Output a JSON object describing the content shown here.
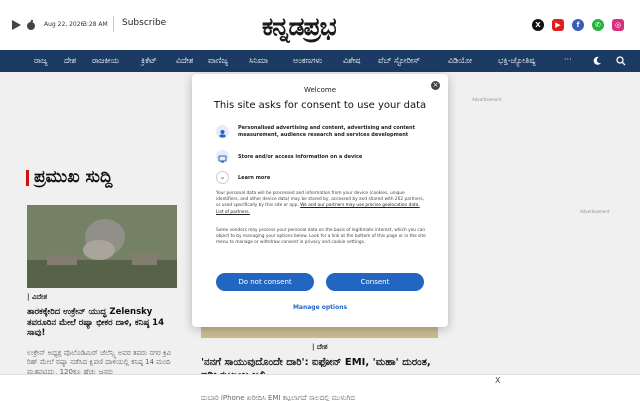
{
  "header": {
    "date": "Aug 22, 2026",
    "time": "3:28 AM",
    "subscribe_label": "Subscribe",
    "logo_text": "ಕನ್ನಡಪ್ರಭ",
    "left_icons": [
      "play-store-icon",
      "apple-icon"
    ],
    "social_icons": [
      "x-icon",
      "youtube-icon",
      "facebook-icon",
      "whatsapp-icon",
      "instagram-icon"
    ],
    "colors": {
      "nav_bg": "#1c3b64",
      "accent": "#d11111"
    }
  },
  "nav": {
    "items": [
      "ರಾಜ್ಯ",
      "ದೇಶ",
      "ರಾಜಕೀಯ",
      "ಕ್ರಿಕೆಟ್",
      "ವಿದೇಶ",
      "ವಾಣಿಜ್ಯ",
      "ಸಿನಿಮಾ",
      "ಅಂಕಣಗಳು",
      "ವಿಶೇಷ",
      "ವೆಬ್ ಸ್ಟೋರೀಸ್",
      "ವಿಡಿಯೋ",
      "ಭಕ್ತಿ-ಜ್ಯೋತಿಷ್ಯ"
    ],
    "more_label": "···",
    "theme_icon": "moon-icon",
    "search_icon": "search-icon"
  },
  "main": {
    "section_title": "ಪ್ರಮುಖ ಸುದ್ದಿ",
    "left_story": {
      "category": "| ವಿದೇಶ",
      "headline": "ತಾರಕಕ್ಕೇರಿದ ಉಕ್ರೇನ್ ಯುದ್ಧ Zelensky ತವರೂರಿನ ಮೇಲೆ ರಷ್ಯಾ ಭೀಕರ ದಾಳಿ, ಕನಿಷ್ಠ 14 ಸಾವು!",
      "summary": "ಉಕ್ರೇನ್ ಅಧ್ಯಕ್ಷ ವೊಲೊಡಿಮಿರ್ ಜೆಲೆನ್ಸ್ಕಿ ಅವರ ತವರು ನಗರ ಕ್ರಿವಿ ರಿಹ್ ಮೇಲೆ ರಷ್ಯಾ ನಡೆಸಿದ ಕ್ಷಿಪಣಿ ದಾಳಿಯಲ್ಲಿ ಕನಿಷ್ಠ 14 ಮಂದಿ ಮೃತಪಟ್ಟಿದ್ದು, 120ಕ್ಕೂ ಹೆಚ್ಚು ಜನರು"
    },
    "center_story": {
      "category": "| ದೇಶ",
      "headline": "'ನನಗೆ ಸಾಯುವುದೊಂದೇ ದಾರಿ': ಐಫೋನ್ EMI, 'ಮಹಾ' ದುರಂತ, ಇಡೀ ಕುಟುಂಬ ಬಲಿ",
      "summary": "ದುಬಾರಿ iPhone ಖರೀದಿಸಿ EMI ಕಟ್ಟಲಾಗದೆ ಸಾಲದಲ್ಲಿ ಮುಳುಗಿದ"
    },
    "advertisement_label": "Advertisement"
  },
  "consent": {
    "welcome": "Welcome",
    "title": "This site asks for consent to use your data",
    "purposes": [
      {
        "icon": "person-icon",
        "text": "Personalised advertising and content, advertising and content measurement, audience research and services development"
      },
      {
        "icon": "device-icon",
        "text": "Store and/or access information on a device"
      }
    ],
    "learn_more": "Learn more",
    "learn_more_icon": "chevron-down-icon",
    "paragraph1": "Your personal data will be processed and information from your device (cookies, unique identifiers, and other device data) may be stored by, accessed by and shared with 202 partners, or used specifically by this site or app.",
    "paragraph1_link": "We and our partners may use precise geolocation data. List of partners.",
    "paragraph2": "Some vendors may process your personal data on the basis of legitimate interest, which you can object to by managing your options below. Look for a link at the bottom of this page or in the site menu to manage or withdraw consent in privacy and cookie settings.",
    "do_not_consent": "Do not consent",
    "consent": "Consent",
    "manage_options": "Manage options",
    "close_icon": "close-icon"
  },
  "bottom_bar": {
    "close_label": "X"
  }
}
